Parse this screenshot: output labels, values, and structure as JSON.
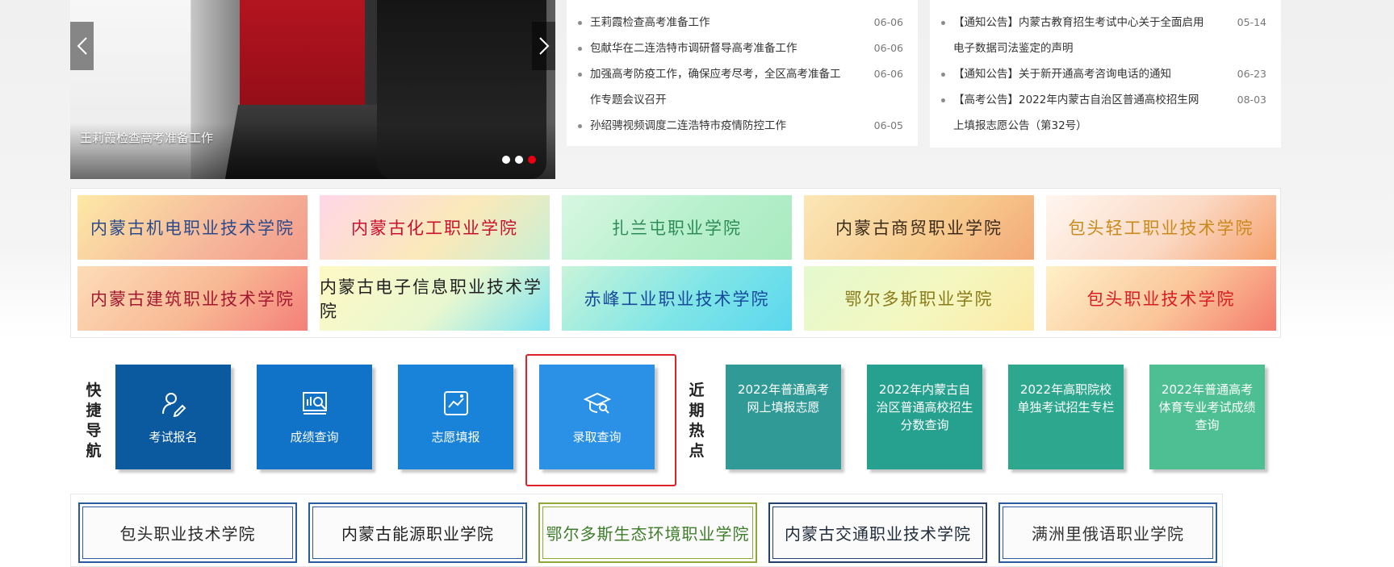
{
  "carousel": {
    "caption": "王莉霞检查高考准备工作",
    "prev_icon": "chevron-left-icon",
    "next_icon": "chevron-right-icon",
    "slide_count": 3,
    "active_slide": 3
  },
  "news_left": [
    {
      "title": "王莉霞检查高考准备工作",
      "date": "06-06"
    },
    {
      "title": "包献华在二连浩特市调研督导高考准备工作",
      "date": "06-06"
    },
    {
      "title": "加强高考防疫工作，确保应考尽考，全区高考准备工",
      "date": "06-06"
    },
    {
      "title": "作专题会议召开",
      "date": ""
    },
    {
      "title": "孙绍骋视频调度二连浩特市疫情防控工作",
      "date": "06-05"
    }
  ],
  "news_right": [
    {
      "title": "【通知公告】内蒙古教育招生考试中心关于全面启用",
      "date": "05-14"
    },
    {
      "title": "电子数据司法鉴定的声明",
      "date": ""
    },
    {
      "title": "【通知公告】关于新开通高考咨询电话的通知",
      "date": "06-23"
    },
    {
      "title": "【高考公告】2022年内蒙古自治区普通高校招生网",
      "date": "08-03"
    },
    {
      "title": "上填报志愿公告（第32号）",
      "date": ""
    }
  ],
  "school_logos_top": [
    {
      "name": "内蒙古机电职业技术学院",
      "color": "#2a4a8a",
      "bg": "linear-gradient(135deg,#fde9a6,#f6b79b 60%,#f39a8a)"
    },
    {
      "name": "内蒙古化工职业学院",
      "color": "#c8102e",
      "bg": "linear-gradient(135deg,#ffd6e7,#fbe9b9 55%,#c9efd3)"
    },
    {
      "name": "扎兰屯职业学院",
      "color": "#2e8b57",
      "bg": "linear-gradient(135deg,#d8f7e2,#b6f0cc 55%,#a9eac0)"
    },
    {
      "name": "内蒙古商贸职业学院",
      "color": "#3b2a1a",
      "bg": "linear-gradient(135deg,#fbe7b6,#f7c98d 60%,#f3a878)"
    },
    {
      "name": "包头轻工职业技术学院",
      "color": "#c98a1b",
      "bg": "linear-gradient(135deg,#fff6f0,#fbd9c4 55%,#f6a06e)"
    },
    {
      "name": "内蒙古建筑职业技术学院",
      "color": "#a2182f",
      "bg": "linear-gradient(135deg,#fddcb8,#f8b894 55%,#f47f79)"
    },
    {
      "name": "内蒙古电子信息职业技术学院",
      "color": "#1f1f1f",
      "bg": "linear-gradient(135deg,#fff9c4,#e8f7d0 55%,#7fe3f0)"
    },
    {
      "name": "赤峰工业职业技术学院",
      "color": "#174a9c",
      "bg": "linear-gradient(135deg,#c8f4d9,#7fe5e7 55%,#5ad7ee)"
    },
    {
      "name": "鄂尔多斯职业学院",
      "color": "#8a7a1a",
      "bg": "linear-gradient(135deg,#e4f9cf,#f4f8c0 55%,#fde8a6)"
    },
    {
      "name": "包头职业技术学院",
      "color": "#d91c24",
      "bg": "linear-gradient(135deg,#fff0c8,#fbc59a 55%,#f47c6c)"
    }
  ],
  "quick_nav": {
    "label_chars": [
      "快",
      "捷",
      "导",
      "航"
    ],
    "buttons": [
      {
        "label": "考试报名",
        "icon": "user-edit-icon",
        "color": "#0b5aa0"
      },
      {
        "label": "成绩查询",
        "icon": "chart-search-icon",
        "color": "#1173c7"
      },
      {
        "label": "志愿填报",
        "icon": "trend-image-icon",
        "color": "#1883d8"
      },
      {
        "label": "录取查询",
        "icon": "graduation-cap-search-icon",
        "color": "#2a91e6"
      }
    ]
  },
  "hot_topics": {
    "label_chars": [
      "近",
      "期",
      "热",
      "点"
    ],
    "items": [
      {
        "label": "2022年普通高考网上填报志愿",
        "color": "#2f9a96"
      },
      {
        "label": "2022年内蒙古自治区普通高校招生分数查询",
        "color": "#26a190"
      },
      {
        "label": "2022年高职院校单独考试招生专栏",
        "color": "#2da88f"
      },
      {
        "label": "2022年普通高考体育专业考试成绩查询",
        "color": "#4dbf93"
      }
    ]
  },
  "school_logos_bottom": [
    {
      "name": "包头职业技术学院",
      "color": "#2a2a2a",
      "border": "#2a5aa0"
    },
    {
      "name": "内蒙古能源职业学院",
      "color": "#1f1f1f",
      "border": "#2a5aa0"
    },
    {
      "name": "鄂尔多斯生态环境职业学院",
      "color": "#3e7d2a",
      "border": "#8fa83a"
    },
    {
      "name": "内蒙古交通职业技术学院",
      "color": "#1f2a3a",
      "border": "#23406f"
    },
    {
      "name": "满洲里俄语职业学院",
      "color": "#333333",
      "border": "#2a5aa0"
    }
  ]
}
